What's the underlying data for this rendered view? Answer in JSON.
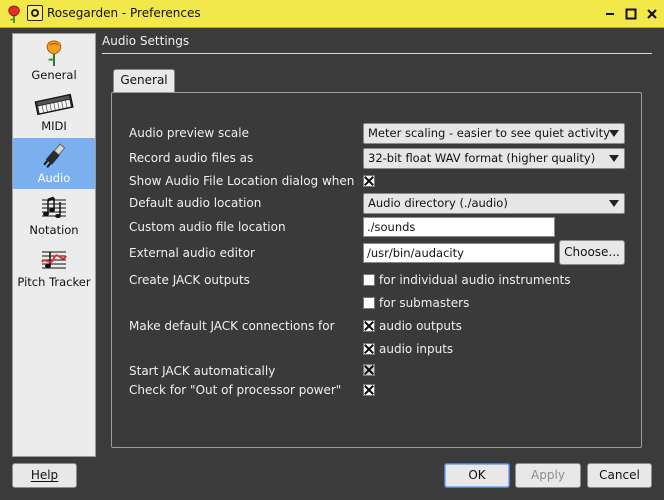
{
  "window": {
    "title": "Rosegarden - Preferences",
    "icons": {
      "app": "rose-icon",
      "menu": "window-menu-icon",
      "minimize": "minimize-icon",
      "maximize": "maximize-icon",
      "close": "close-icon"
    }
  },
  "sidebar": {
    "items": [
      {
        "label": "General",
        "icon": "rose-icon",
        "selected": false
      },
      {
        "label": "MIDI",
        "icon": "keyboard-icon",
        "selected": false
      },
      {
        "label": "Audio",
        "icon": "audio-jack-icon",
        "selected": true
      },
      {
        "label": "Notation",
        "icon": "notation-icon",
        "selected": false
      },
      {
        "label": "Pitch Tracker",
        "icon": "pitch-tracker-icon",
        "selected": false
      }
    ]
  },
  "header": {
    "title": "Audio Settings"
  },
  "tabs": [
    {
      "label": "General",
      "active": true
    }
  ],
  "settings": {
    "preview_scale": {
      "label": "Audio preview scale",
      "value": "Meter scaling - easier to see quiet activity"
    },
    "record_format": {
      "label": "Record audio files as",
      "value": "32-bit float WAV format (higher quality)"
    },
    "show_location_dialog": {
      "label": "Show Audio File Location dialog when saving",
      "checked": true
    },
    "default_location": {
      "label": "Default audio location",
      "value": "Audio directory (./audio)"
    },
    "custom_location": {
      "label": "Custom audio file location",
      "value": "./sounds"
    },
    "external_editor": {
      "label": "External audio editor",
      "value": "/usr/bin/audacity",
      "choose_label": "Choose..."
    },
    "jack_outputs": {
      "label": "Create JACK outputs",
      "options": [
        {
          "label": "for individual audio instruments",
          "checked": false
        },
        {
          "label": "for submasters",
          "checked": false
        }
      ]
    },
    "jack_connections": {
      "label": "Make default JACK connections for",
      "options": [
        {
          "label": "audio outputs",
          "checked": true
        },
        {
          "label": "audio inputs",
          "checked": true
        }
      ]
    },
    "start_jack": {
      "label": "Start JACK automatically",
      "checked": true,
      "state": "partial"
    },
    "processor_power": {
      "label": "Check for \"Out of processor power\"",
      "checked": true
    }
  },
  "buttons": {
    "help": "Help",
    "ok": "OK",
    "apply": "Apply",
    "cancel": "Cancel"
  },
  "colors": {
    "titlebar": "#f2e84a",
    "background": "#3b3b3b",
    "selection": "#7aaff0"
  }
}
